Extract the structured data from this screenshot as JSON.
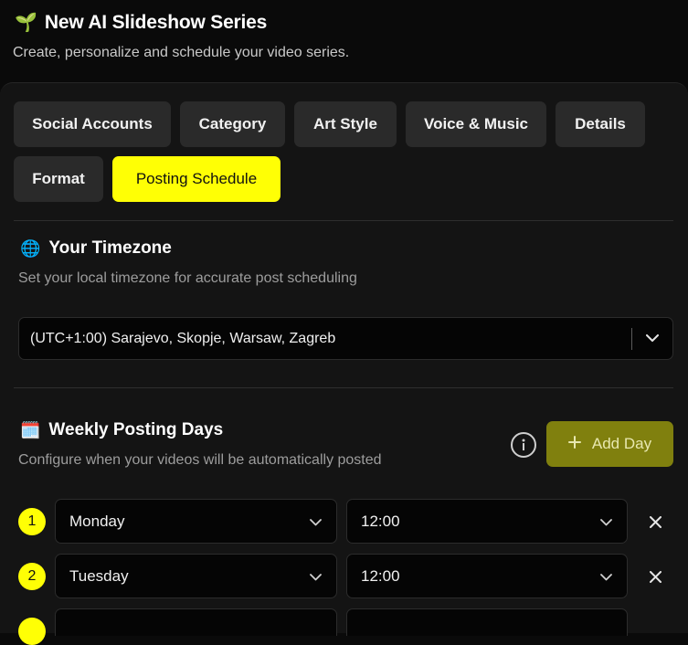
{
  "header": {
    "emoji": "🌱",
    "title": "New AI Slideshow Series",
    "subtitle": "Create, personalize and schedule your video series."
  },
  "tabs": [
    {
      "label": "Social Accounts",
      "active": false
    },
    {
      "label": "Category",
      "active": false
    },
    {
      "label": "Art Style",
      "active": false
    },
    {
      "label": "Voice & Music",
      "active": false
    },
    {
      "label": "Details",
      "active": false
    },
    {
      "label": "Format",
      "active": false
    },
    {
      "label": "Posting Schedule",
      "active": true
    }
  ],
  "timezone": {
    "emoji": "🌐",
    "title": "Your Timezone",
    "description": "Set your local timezone for accurate post scheduling",
    "selected": "(UTC+1:00) Sarajevo, Skopje, Warsaw, Zagreb"
  },
  "weekly": {
    "emoji": "🗓️",
    "title": "Weekly Posting Days",
    "description": "Configure when your videos will be automatically posted",
    "add_label": "Add Day",
    "rows": [
      {
        "num": "1",
        "day": "Monday",
        "time": "12:00"
      },
      {
        "num": "2",
        "day": "Tuesday",
        "time": "12:00"
      }
    ]
  },
  "colors": {
    "accent": "#ffff05",
    "add_button": "#80800e",
    "panel": "#141414",
    "background": "#0a0a0a"
  },
  "icons": [
    "chevron-down-icon",
    "info-icon",
    "plus-icon",
    "close-icon"
  ]
}
